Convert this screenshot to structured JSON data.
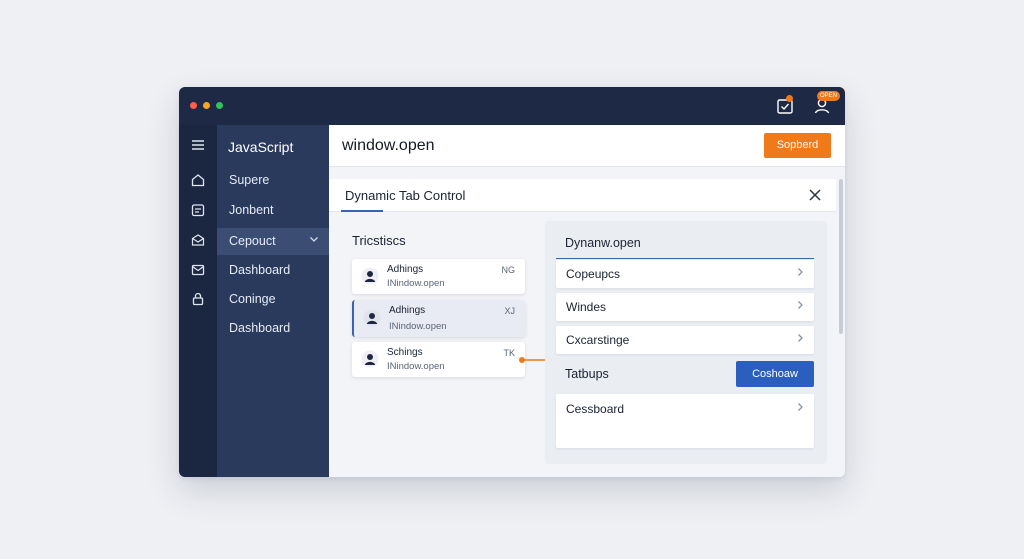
{
  "titlebar": {
    "badge_text": "OPEN",
    "icons": [
      "inbox-check-icon",
      "user-icon"
    ]
  },
  "rail": {
    "icons": [
      "menu-icon",
      "home-icon",
      "calendar-icon",
      "mail-open-icon",
      "mail-icon",
      "lock-icon"
    ]
  },
  "sidebar": {
    "title": "JavaScript",
    "items": [
      {
        "label": "Supere"
      },
      {
        "label": "Jonbent"
      },
      {
        "label": "Cepouct"
      },
      {
        "label": "Dashboard"
      },
      {
        "label": "Coninge"
      },
      {
        "label": "Dashboard"
      }
    ]
  },
  "header": {
    "title": "window.open",
    "button_label": "Sopberd"
  },
  "dialog": {
    "title": "Dynamic Tab Control",
    "left": {
      "title": "Tricstiscs",
      "cards": [
        {
          "name": "Adhings",
          "sub": "INindow.open",
          "key": "NG"
        },
        {
          "name": "Adhings",
          "sub": "INindow.open",
          "key": "XJ"
        },
        {
          "name": "Schings",
          "sub": "INindow.open",
          "key": "TK"
        }
      ]
    },
    "right": {
      "title": "Dynanw.open",
      "items": [
        {
          "label": "Copeupcs"
        },
        {
          "label": "Windes"
        },
        {
          "label": "Cxcarstinge"
        }
      ],
      "subheading": "Tatbups",
      "button_label": "Coshoaw",
      "big_item": "Cessboard"
    }
  },
  "colors": {
    "titlebar": "#1e2a45",
    "sidebar": "#2a3a5c",
    "accent_orange": "#f07a1a",
    "accent_blue": "#2a5fbd"
  }
}
